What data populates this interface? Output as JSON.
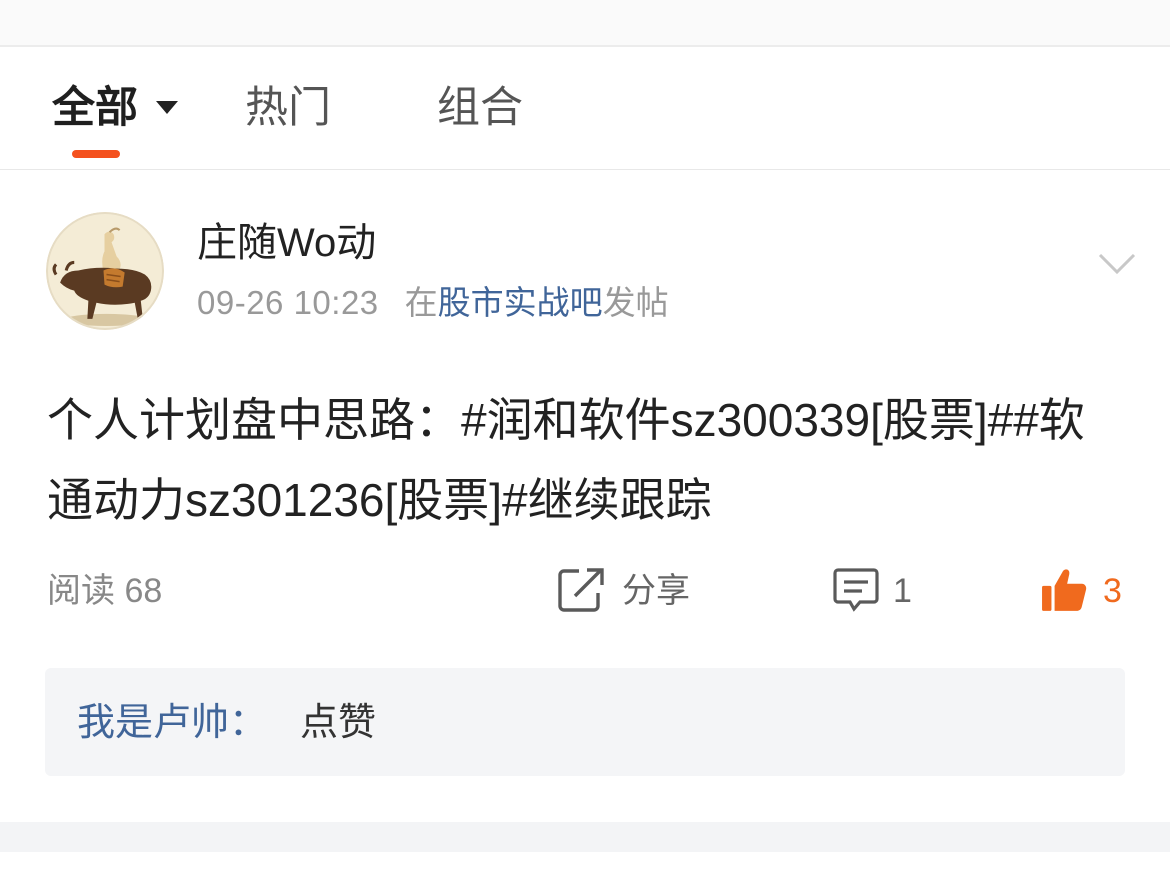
{
  "tabs": {
    "active_index": 0,
    "items": [
      {
        "label": "全部"
      },
      {
        "label": "热门"
      },
      {
        "label": "组合"
      }
    ]
  },
  "icons": {
    "tab_dropdown": "dropdown-triangle-icon",
    "post_menu": "chevron-down-icon",
    "share": "share-icon",
    "comment": "comment-icon",
    "like": "thumbs-up-icon"
  },
  "colors": {
    "accent": "#f4511e",
    "link": "#406599",
    "text": "#222222",
    "muted": "#999999",
    "like": "#f06a1e"
  },
  "post": {
    "author": "庄随Wo动",
    "time": "09-26 10:23",
    "posted_in_prefix": "在",
    "forum": "股市实战吧",
    "posted_in_suffix": "发帖",
    "content": "个人计划盘中思路：#润和软件sz300339[股票]##软通动力sz301236[股票]#继续跟踪",
    "stats": {
      "read_label": "阅读",
      "read_count": "68",
      "share_label": "分享",
      "comment_count": "1",
      "like_count": "3"
    }
  },
  "comments": [
    {
      "author": "我是卢帅：",
      "text": "点赞"
    }
  ]
}
